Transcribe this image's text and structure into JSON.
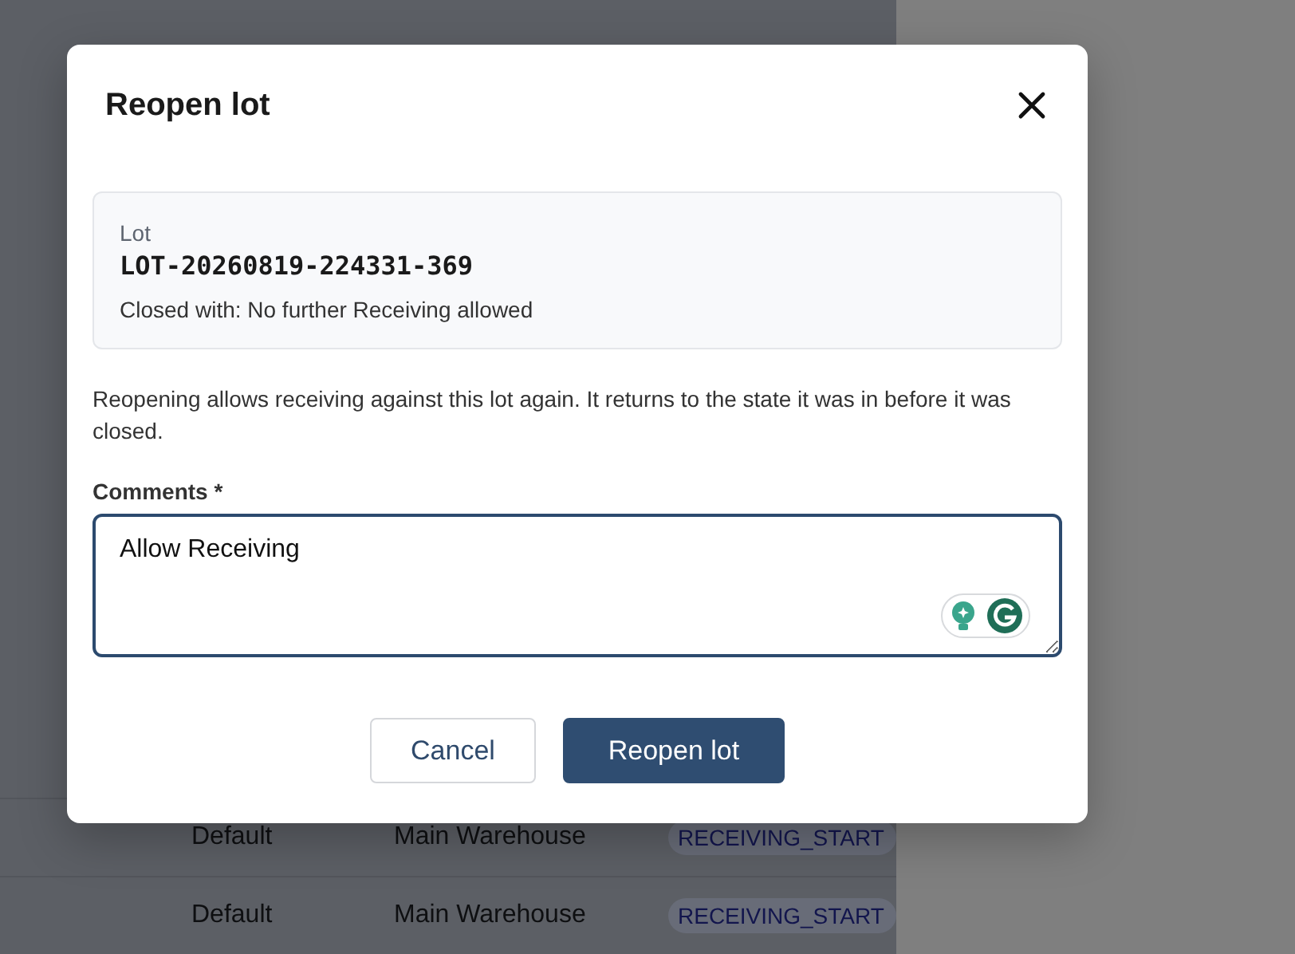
{
  "background_table": {
    "rows": [
      {
        "column_1": "Default",
        "column_2": "Main Warehouse",
        "status": "RECEIVING_START"
      },
      {
        "column_1": "Default",
        "column_2": "Main Warehouse",
        "status": "RECEIVING_START"
      }
    ]
  },
  "dialog": {
    "title": "Reopen lot",
    "lot_card": {
      "label": "Lot",
      "lot_number": "LOT-20260819-224331-369",
      "closed_with": "Closed with: No further Receiving allowed"
    },
    "description": "Reopening allows receiving against this lot again. It returns to the state it was in before it was closed.",
    "comments": {
      "label": "Comments *",
      "value": "Allow Receiving"
    },
    "buttons": [
      {
        "label": "Cancel",
        "kind": "secondary"
      },
      {
        "label": "Reopen lot",
        "kind": "primary"
      }
    ]
  }
}
